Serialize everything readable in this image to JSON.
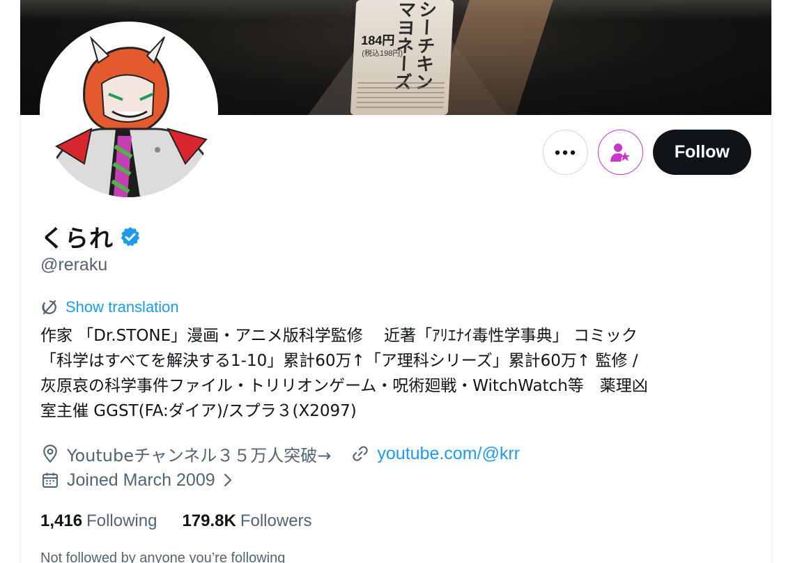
{
  "banner": {
    "price": "184円",
    "price_sub": "(税込198円)",
    "product_text": "シーチキンマヨネーズ"
  },
  "profile": {
    "display_name": "くられ",
    "handle": "@reraku",
    "verified": true
  },
  "actions": {
    "more_icon": "more-dots-icon",
    "subscribe_icon": "person-star-icon",
    "follow_label": "Follow"
  },
  "translate": {
    "label": "Show translation"
  },
  "bio": {
    "lines": [
      "作家 「Dr.STONE」漫画・アニメ版科学監修　 近著「ｱﾘｴﾅｲ毒性学事典」 コミック",
      "「科学はすべてを解決する1-10」累計60万↑「ア理科シリーズ」累計60万↑ 監修 /",
      "灰原哀の科学事件ファイル・トリリオンゲーム・呪術廻戦・WitchWatch等　薬理凶",
      "室主催 GGST(FA:ダイア)/スプラ３(X2097)"
    ]
  },
  "meta": {
    "location": "Youtubeチャンネル３５万人突破→",
    "website": "youtube.com/@krr",
    "joined": "Joined March 2009"
  },
  "stats": {
    "following_count": "1,416",
    "following_label": "Following",
    "followers_count": "179.8K",
    "followers_label": "Followers"
  },
  "followed_note": "Not followed by anyone you’re following",
  "colors": {
    "accent": "#1d9bf0",
    "subscribe": "#c936cc",
    "text_secondary": "#536471"
  }
}
